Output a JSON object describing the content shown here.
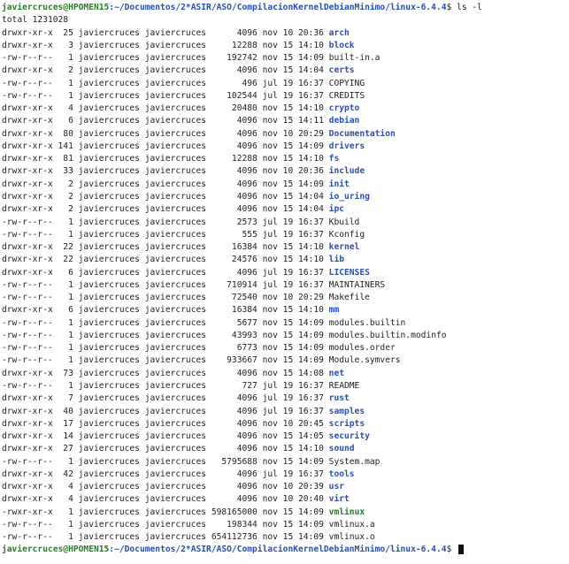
{
  "terminal": {
    "prompt_user": "javiercruces@HPOMEN15",
    "prompt_path": ":~/Documentos/2*ASIR/ASO/CompilacionKernelDebianMinimo/linux-6.4.4",
    "prompt_symbol": "$",
    "command": " ls -l",
    "total_line": "total 1231028",
    "colors": {
      "user": "#2a7a2a",
      "path": "#2a4fb0",
      "dir": "#2a4fb0",
      "exec": "#2a7a2a",
      "text": "#1e1e1e"
    },
    "entries": [
      {
        "meta": "drwxr-xr-x  25 javiercruces javiercruces      4096 nov 10 20:36 ",
        "name": "arch",
        "type": "dir"
      },
      {
        "meta": "drwxr-xr-x   3 javiercruces javiercruces     12288 nov 15 14:10 ",
        "name": "block",
        "type": "dir"
      },
      {
        "meta": "-rw-r--r--   1 javiercruces javiercruces    192742 nov 15 14:09 ",
        "name": "built-in.a",
        "type": "file"
      },
      {
        "meta": "drwxr-xr-x   2 javiercruces javiercruces      4096 nov 15 14:04 ",
        "name": "certs",
        "type": "dir"
      },
      {
        "meta": "-rw-r--r--   1 javiercruces javiercruces       496 jul 19 16:37 ",
        "name": "COPYING",
        "type": "file"
      },
      {
        "meta": "-rw-r--r--   1 javiercruces javiercruces    102544 jul 19 16:37 ",
        "name": "CREDITS",
        "type": "file"
      },
      {
        "meta": "drwxr-xr-x   4 javiercruces javiercruces     20480 nov 15 14:10 ",
        "name": "crypto",
        "type": "dir"
      },
      {
        "meta": "drwxr-xr-x   6 javiercruces javiercruces      4096 nov 15 14:11 ",
        "name": "debian",
        "type": "dir"
      },
      {
        "meta": "drwxr-xr-x  80 javiercruces javiercruces      4096 nov 10 20:29 ",
        "name": "Documentation",
        "type": "dir"
      },
      {
        "meta": "drwxr-xr-x 141 javiercruces javiercruces      4096 nov 15 14:09 ",
        "name": "drivers",
        "type": "dir"
      },
      {
        "meta": "drwxr-xr-x  81 javiercruces javiercruces     12288 nov 15 14:10 ",
        "name": "fs",
        "type": "dir"
      },
      {
        "meta": "drwxr-xr-x  33 javiercruces javiercruces      4096 nov 10 20:36 ",
        "name": "include",
        "type": "dir"
      },
      {
        "meta": "drwxr-xr-x   2 javiercruces javiercruces      4096 nov 15 14:09 ",
        "name": "init",
        "type": "dir"
      },
      {
        "meta": "drwxr-xr-x   2 javiercruces javiercruces      4096 nov 15 14:04 ",
        "name": "io_uring",
        "type": "dir"
      },
      {
        "meta": "drwxr-xr-x   2 javiercruces javiercruces      4096 nov 15 14:04 ",
        "name": "ipc",
        "type": "dir"
      },
      {
        "meta": "-rw-r--r--   1 javiercruces javiercruces      2573 jul 19 16:37 ",
        "name": "Kbuild",
        "type": "file"
      },
      {
        "meta": "-rw-r--r--   1 javiercruces javiercruces       555 jul 19 16:37 ",
        "name": "Kconfig",
        "type": "file"
      },
      {
        "meta": "drwxr-xr-x  22 javiercruces javiercruces     16384 nov 15 14:10 ",
        "name": "kernel",
        "type": "dir"
      },
      {
        "meta": "drwxr-xr-x  22 javiercruces javiercruces     24576 nov 15 14:10 ",
        "name": "lib",
        "type": "dir"
      },
      {
        "meta": "drwxr-xr-x   6 javiercruces javiercruces      4096 jul 19 16:37 ",
        "name": "LICENSES",
        "type": "dir"
      },
      {
        "meta": "-rw-r--r--   1 javiercruces javiercruces    710914 jul 19 16:37 ",
        "name": "MAINTAINERS",
        "type": "file"
      },
      {
        "meta": "-rw-r--r--   1 javiercruces javiercruces     72540 nov 10 20:29 ",
        "name": "Makefile",
        "type": "file"
      },
      {
        "meta": "drwxr-xr-x   6 javiercruces javiercruces     16384 nov 15 14:10 ",
        "name": "mm",
        "type": "dir"
      },
      {
        "meta": "-rw-r--r--   1 javiercruces javiercruces      5677 nov 15 14:09 ",
        "name": "modules.builtin",
        "type": "file"
      },
      {
        "meta": "-rw-r--r--   1 javiercruces javiercruces     43993 nov 15 14:09 ",
        "name": "modules.builtin.modinfo",
        "type": "file"
      },
      {
        "meta": "-rw-r--r--   1 javiercruces javiercruces      6773 nov 15 14:09 ",
        "name": "modules.order",
        "type": "file"
      },
      {
        "meta": "-rw-r--r--   1 javiercruces javiercruces    933667 nov 15 14:09 ",
        "name": "Module.symvers",
        "type": "file"
      },
      {
        "meta": "drwxr-xr-x  73 javiercruces javiercruces      4096 nov 15 14:08 ",
        "name": "net",
        "type": "dir"
      },
      {
        "meta": "-rw-r--r--   1 javiercruces javiercruces       727 jul 19 16:37 ",
        "name": "README",
        "type": "file"
      },
      {
        "meta": "drwxr-xr-x   7 javiercruces javiercruces      4096 jul 19 16:37 ",
        "name": "rust",
        "type": "dir"
      },
      {
        "meta": "drwxr-xr-x  40 javiercruces javiercruces      4096 jul 19 16:37 ",
        "name": "samples",
        "type": "dir"
      },
      {
        "meta": "drwxr-xr-x  17 javiercruces javiercruces      4096 nov 10 20:45 ",
        "name": "scripts",
        "type": "dir"
      },
      {
        "meta": "drwxr-xr-x  14 javiercruces javiercruces      4096 nov 15 14:05 ",
        "name": "security",
        "type": "dir"
      },
      {
        "meta": "drwxr-xr-x  27 javiercruces javiercruces      4096 nov 15 14:10 ",
        "name": "sound",
        "type": "dir"
      },
      {
        "meta": "-rw-r--r--   1 javiercruces javiercruces   5795688 nov 15 14:09 ",
        "name": "System.map",
        "type": "file"
      },
      {
        "meta": "drwxr-xr-x  42 javiercruces javiercruces      4096 jul 19 16:37 ",
        "name": "tools",
        "type": "dir"
      },
      {
        "meta": "drwxr-xr-x   4 javiercruces javiercruces      4096 nov 10 20:39 ",
        "name": "usr",
        "type": "dir"
      },
      {
        "meta": "drwxr-xr-x   4 javiercruces javiercruces      4096 nov 10 20:40 ",
        "name": "virt",
        "type": "dir"
      },
      {
        "meta": "-rwxr-xr-x   1 javiercruces javiercruces 598165000 nov 15 14:09 ",
        "name": "vmlinux",
        "type": "exec"
      },
      {
        "meta": "-rw-r--r--   1 javiercruces javiercruces    198344 nov 15 14:09 ",
        "name": "vmlinux.a",
        "type": "file"
      },
      {
        "meta": "-rw-r--r--   1 javiercruces javiercruces 654112736 nov 15 14:09 ",
        "name": "vmlinux.o",
        "type": "file"
      }
    ]
  }
}
